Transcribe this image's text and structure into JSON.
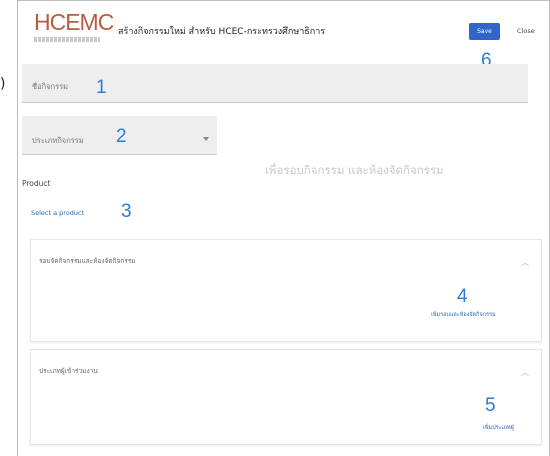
{
  "stray_text": ")",
  "header": {
    "logo_text": "HCEMC",
    "title": "สร้างกิจกรรมใหม่ สำหรับ HCEC-กระทรวงศึกษาธิการ",
    "save_label": "Save",
    "close_label": "Close"
  },
  "form": {
    "activity_name_label": "ชื่อกิจกรรม",
    "activity_type_label": "ประเภทกิจกรรม",
    "hint": "เพื่อรอบกิจกรรม และห้องจัดกิจกรรม",
    "product_label": "Product",
    "select_product_link": "Select a product"
  },
  "sections": [
    {
      "title": "รอบจัดกิจกรรมและห้องจัดกิจกรรม",
      "link": "เพิ่มรอบและห้องจัดกิจกรรม"
    },
    {
      "title": "ประเภทผู้เข้าร่วมงาน",
      "link": "เพิ่มประเภทผู้"
    }
  ],
  "annotations": [
    "1",
    "2",
    "3",
    "4",
    "5",
    "6"
  ],
  "colors": {
    "accent": "#2f66c7",
    "annotation": "#2f7bd8",
    "logo": "#b35e45"
  }
}
